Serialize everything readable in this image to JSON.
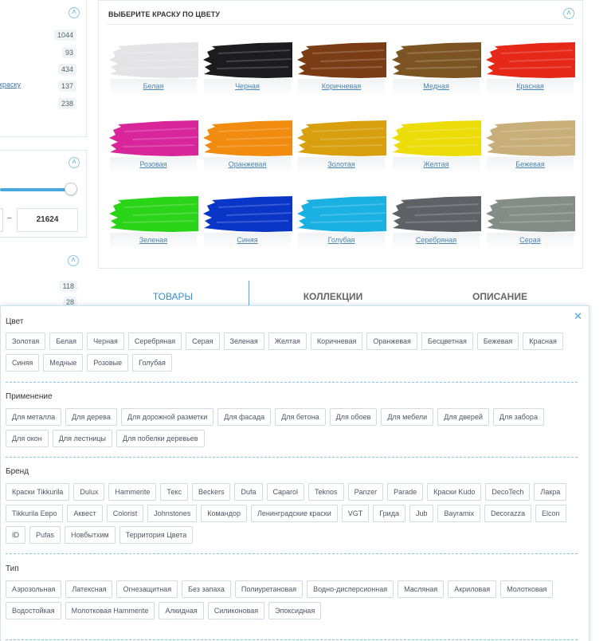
{
  "sidebar": {
    "counts": [
      "1044",
      "93",
      "434",
      "137",
      "238"
    ],
    "link_text": "краску",
    "price_to": "21624",
    "price_dash": "–",
    "counts2": [
      "118",
      "28"
    ]
  },
  "palette": {
    "title": "ВЫБЕРИТЕ КРАСКУ ПО ЦВЕТУ",
    "colors": [
      {
        "label": "Белая",
        "hex": "#e4e4e6"
      },
      {
        "label": "Черная",
        "hex": "#1c1c1e"
      },
      {
        "label": "Коричневая",
        "hex": "#7a3c14"
      },
      {
        "label": "Медная",
        "hex": "#7c5424"
      },
      {
        "label": "Красная",
        "hex": "#e62818"
      },
      {
        "label": "Розовая",
        "hex": "#d8259a"
      },
      {
        "label": "Оранжевая",
        "hex": "#f28c10"
      },
      {
        "label": "Золотая",
        "hex": "#d8a00e"
      },
      {
        "label": "Желтая",
        "hex": "#ecdc0a"
      },
      {
        "label": "Бежевая",
        "hex": "#c8ae78"
      },
      {
        "label": "Зеленая",
        "hex": "#2ad418"
      },
      {
        "label": "Синяя",
        "hex": "#0a36c8"
      },
      {
        "label": "Голубая",
        "hex": "#1ab0e2"
      },
      {
        "label": "Серебряная",
        "hex": "#5e6166"
      },
      {
        "label": "Серая",
        "hex": "#848c88"
      }
    ]
  },
  "tabs": [
    "ТОВАРЫ",
    "КОЛЛЕКЦИИ",
    "ОПИСАНИЕ"
  ],
  "filters": [
    {
      "title": "Цвет",
      "items": [
        "Золотая",
        "Белая",
        "Черная",
        "Серебряная",
        "Серая",
        "Зеленая",
        "Желтая",
        "Коричневая",
        "Оранжевая",
        "Бесцветная",
        "Бежевая",
        "Красная",
        "Синяя",
        "Медные",
        "Розовые",
        "Голубая"
      ]
    },
    {
      "title": "Применение",
      "items": [
        "Для металла",
        "Для дерева",
        "Для дорожной разметки",
        "Для фасада",
        "Для бетона",
        "Для обоев",
        "Для мебели",
        "Для дверей",
        "Для забора",
        "Для окон",
        "Для лестницы",
        "Для побелки деревьев"
      ]
    },
    {
      "title": "Бренд",
      "items": [
        "Краски Tikkurila",
        "Dulux",
        "Hammerite",
        "Текс",
        "Beckers",
        "Dufa",
        "Caparol",
        "Teknos",
        "Panzer",
        "Parade",
        "Краски Kudo",
        "DecoTech",
        "Лакра",
        "Tikkurila Евро",
        "Аквест",
        "Colorist",
        "Johnstones",
        "Командор",
        "Ленинградские краски",
        "VGT",
        "Грида",
        "Jub",
        "Bayramix",
        "Decorazza",
        "Elcon",
        "ID",
        "Pufas",
        "Новбытхим",
        "Территория Цвета"
      ]
    },
    {
      "title": "Тип",
      "items": [
        "Аэрозольная",
        "Латексная",
        "Огнезащитная",
        "Без запаха",
        "Полиуретановая",
        "Водно-дисперсионная",
        "Масляная",
        "Акриловая",
        "Молотковая",
        "Водостойкая",
        "Молотковая Hammerite",
        "Алкидная",
        "Силиконовая",
        "Эпоксидная"
      ]
    }
  ],
  "icons": {
    "collapse": "chevron-up-icon",
    "close": "close-icon"
  }
}
